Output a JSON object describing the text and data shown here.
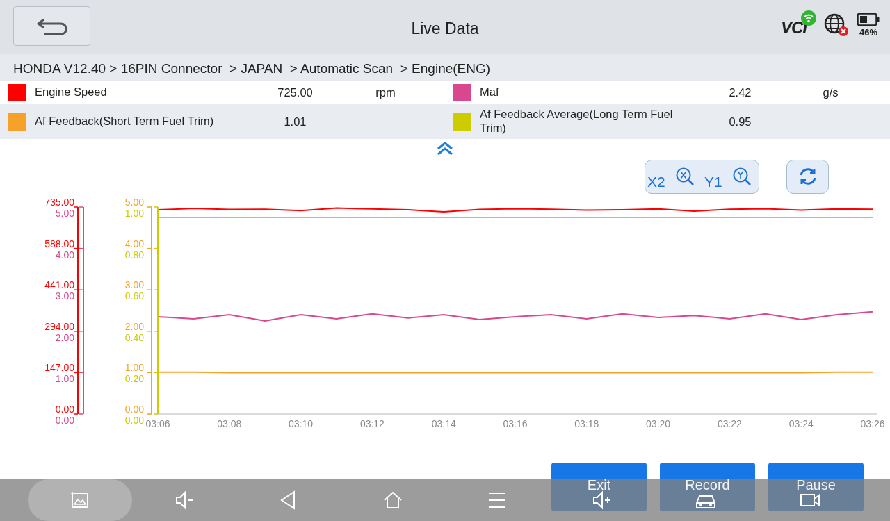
{
  "header": {
    "title": "Live Data",
    "vci_logo": "VCI",
    "battery_reading": "46%"
  },
  "breadcrumb": "HONDA V12.40 > 16PIN Connector  > JAPAN  > Automatic Scan  > Engine(ENG)",
  "legend_rows": [
    [
      {
        "name": "Engine Speed",
        "value": "725.00",
        "unit": "rpm",
        "color": "#ff0000"
      },
      {
        "name": "Maf",
        "value": "2.42",
        "unit": "g/s",
        "color": "#d9488f"
      }
    ],
    [
      {
        "name": "Af Feedback(Short Term Fuel Trim)",
        "value": "1.01",
        "color": "#f5a12a"
      },
      {
        "name": "Af Feedback Average(Long Term Fuel Trim)",
        "value": "0.95",
        "color": "#cccc00"
      }
    ]
  ],
  "zoom_controls": [
    {
      "kind": "x",
      "label": "X2"
    },
    {
      "kind": "y",
      "label": "Y1"
    }
  ],
  "charts": [
    {
      "chart_data": {
        "type": "line",
        "categories": [
          "03:06",
          null,
          "03:08",
          null,
          "03:10",
          null,
          "03:12",
          null,
          "03:14",
          null,
          "03:16",
          null,
          "03:18",
          null,
          "03:20",
          null,
          "03:22",
          null,
          "03:24",
          null,
          "03:26"
        ],
        "ylim": [
          0,
          735
        ],
        "yticks": [
          {
            "value": 735,
            "label": "735.00"
          },
          {
            "value": 588,
            "label": "588.00"
          },
          {
            "value": 441,
            "label": "441.00"
          },
          {
            "value": 294,
            "label": "294.00"
          },
          {
            "value": 147,
            "label": "147.00"
          },
          {
            "value": 0,
            "label": "0.00"
          }
        ],
        "series": [
          {
            "color": "#ff0000",
            "values": [
              725,
              730,
              726,
              727,
              722,
              731,
              728,
              725,
              718,
              726,
              729,
              727,
              724,
              725,
              728,
              720,
              727,
              729,
              724,
              728,
              727
            ]
          }
        ]
      }
    },
    {
      "chart_data": {
        "type": "line",
        "categories": [
          null,
          null,
          null,
          null,
          null,
          null,
          null,
          null,
          null,
          null,
          null,
          null,
          null,
          null,
          null,
          null,
          null,
          null,
          null,
          null,
          null
        ],
        "ylim": [
          0,
          5
        ],
        "yticks": [
          {
            "value": 5,
            "label": "5.00"
          },
          {
            "value": 4,
            "label": "4.00"
          },
          {
            "value": 3,
            "label": "3.00"
          },
          {
            "value": 2,
            "label": "2.00"
          },
          {
            "value": 1,
            "label": "1.00"
          },
          {
            "value": 0,
            "label": "0.00"
          }
        ],
        "series": [
          {
            "color": "#d9488f",
            "values": [
              2.35,
              2.3,
              2.4,
              2.25,
              2.4,
              2.3,
              2.42,
              2.32,
              2.4,
              2.28,
              2.35,
              2.4,
              2.3,
              2.42,
              2.33,
              2.38,
              2.3,
              2.42,
              2.28,
              2.4,
              2.47
            ]
          }
        ]
      }
    },
    {
      "chart_data": {
        "type": "line",
        "categories": [
          null,
          null,
          null,
          null,
          null,
          null,
          null,
          null,
          null,
          null,
          null,
          null,
          null,
          null,
          null,
          null,
          null,
          null,
          null,
          null,
          null
        ],
        "ylim": [
          0,
          5
        ],
        "yticks": [
          {
            "value": 5,
            "label": "5.00"
          },
          {
            "value": 4,
            "label": "4.00"
          },
          {
            "value": 3,
            "label": "3.00"
          },
          {
            "value": 2,
            "label": "2.00"
          },
          {
            "value": 1,
            "label": "1.00"
          },
          {
            "value": 0,
            "label": "0.00"
          }
        ],
        "series": [
          {
            "color": "#f5a12a",
            "values": [
              1.01,
              1.01,
              1.0,
              1.0,
              1.0,
              1.0,
              1.0,
              1.0,
              1.0,
              1.0,
              1.0,
              1.0,
              1.0,
              1.0,
              1.0,
              1.0,
              1.0,
              1.0,
              1.0,
              1.01,
              1.01
            ]
          }
        ]
      }
    },
    {
      "chart_data": {
        "type": "line",
        "categories": [
          null,
          null,
          null,
          null,
          null,
          null,
          null,
          null,
          null,
          null,
          null,
          null,
          null,
          null,
          null,
          null,
          null,
          null,
          null,
          null,
          null
        ],
        "ylim": [
          0,
          1
        ],
        "yticks": [
          {
            "value": 1,
            "label": "1.00"
          },
          {
            "value": 0.8,
            "label": "0.80"
          },
          {
            "value": 0.6,
            "label": "0.60"
          },
          {
            "value": 0.4,
            "label": "0.40"
          },
          {
            "value": 0.2,
            "label": "0.20"
          },
          {
            "value": 0,
            "label": "0.00"
          }
        ],
        "series": [
          {
            "color": "#cccc00",
            "values": [
              0.95,
              0.95,
              0.95,
              0.95,
              0.95,
              0.95,
              0.95,
              0.95,
              0.95,
              0.95,
              0.95,
              0.95,
              0.95,
              0.95,
              0.95,
              0.95,
              0.95,
              0.95,
              0.95,
              0.95,
              0.95
            ]
          }
        ]
      }
    }
  ],
  "buttons": [
    "Exit",
    "Record",
    "Pause"
  ],
  "nav_bar": [
    {
      "kind": "screenshot",
      "selected": true
    },
    {
      "kind": "volume-down",
      "selected": false
    },
    {
      "kind": "back",
      "selected": false
    },
    {
      "kind": "home",
      "selected": false
    },
    {
      "kind": "menu",
      "selected": false
    },
    {
      "kind": "volume-up",
      "selected": false
    },
    {
      "kind": "car",
      "selected": false
    },
    {
      "kind": "screen-record",
      "selected": false
    }
  ]
}
